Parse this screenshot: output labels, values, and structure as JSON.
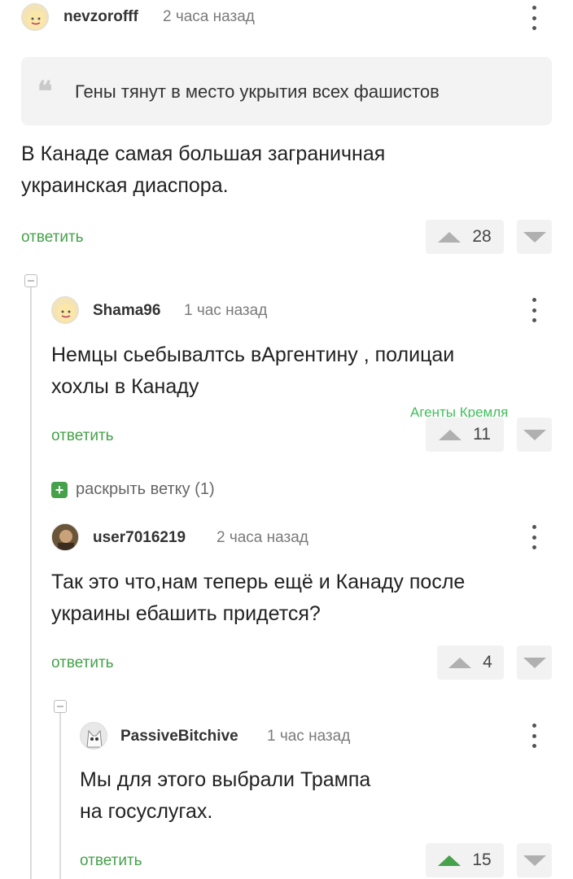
{
  "comments": [
    {
      "username": "nevzorofff",
      "time": "2 часа назад",
      "quote": "Гены тянут в место укрытия всех фашистов",
      "text": [
        "В Канаде самая большая заграничная",
        "украинская диаспора."
      ],
      "reply_label": "ответить",
      "score": "28"
    },
    {
      "username": "Shama96",
      "time": "1 час назад",
      "text": [
        "Немцы сьебывалтсь вАргентину , полицаи",
        "хохлы в Канаду"
      ],
      "reply_label": "ответить",
      "score": "11"
    },
    {
      "username": "user7016219",
      "time": "2 часа назад",
      "text": [
        "Так это что,нам теперь ещё и Канаду после",
        "украины ебашить придется?"
      ],
      "reply_label": "ответить",
      "score": "4"
    },
    {
      "username": "PassiveBitchive",
      "time": "1 час назад",
      "text": [
        "Мы для этого выбрали Трампа",
        "на госуслугах."
      ],
      "reply_label": "ответить",
      "score": "15"
    }
  ],
  "expand_thread": {
    "icon": "+",
    "label": "раскрыть ветку (1)"
  },
  "watermark": "Агенты Кремля",
  "colors": {
    "accent": "#45a14a",
    "watermark": "#3fbf5a"
  },
  "icons": [
    "avatar",
    "kebab-menu-icon",
    "quote-icon",
    "upvote-icon",
    "downvote-icon",
    "collapse-icon",
    "expand-icon"
  ]
}
